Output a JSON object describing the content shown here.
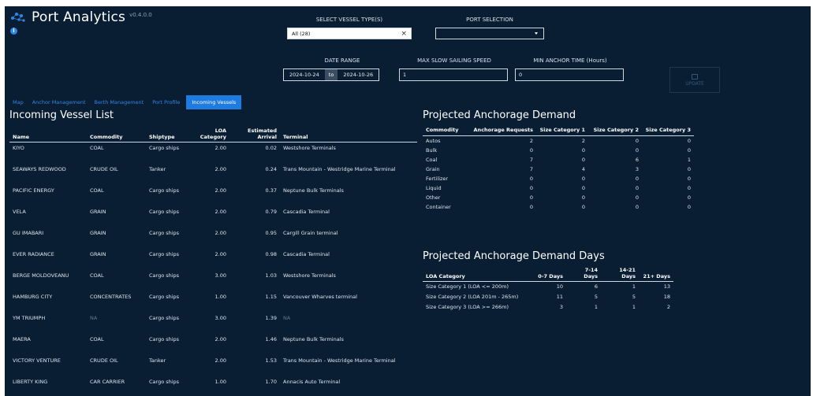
{
  "header": {
    "title": "Port Analytics",
    "version": "v0.4.0.0"
  },
  "filters": {
    "vessel_type_label": "SELECT VESSEL TYPE(S)",
    "vessel_type_value": "All (28)",
    "port_selection_label": "PORT SELECTION",
    "port_selection_value": "",
    "date_range_label": "DATE RANGE",
    "date_start": "2024-10-24",
    "date_to": "to",
    "date_end": "2024-10-26",
    "max_speed_label": "MAX SLOW SAILING SPEED",
    "max_speed_value": "1",
    "min_anchor_label": "MIN ANCHOR TIME (Hours)",
    "min_anchor_value": "0",
    "apply_label": "UPDATE"
  },
  "tabs": [
    {
      "label": "Map",
      "active": false
    },
    {
      "label": "Anchor Management",
      "active": false
    },
    {
      "label": "Berth Management",
      "active": false
    },
    {
      "label": "Port Profile",
      "active": false
    },
    {
      "label": "Incoming Vessels",
      "active": true
    }
  ],
  "vessel_list": {
    "title": "Incoming Vessel List",
    "headers": {
      "name": "Name",
      "commodity": "Commodity",
      "shiptype": "Shiptype",
      "loa_line1": "LOA",
      "loa_line2": "Category",
      "arrival_line1": "Estimated",
      "arrival_line2": "Arrival",
      "terminal": "Terminal"
    },
    "rows": [
      {
        "name": "KIYO",
        "commodity": "COAL",
        "shiptype": "Cargo ships",
        "loa": "2.00",
        "arrival": "0.02",
        "terminal": "Westshore Terminals"
      },
      {
        "name": "SEAWAYS REDWOOD",
        "commodity": "CRUDE OIL",
        "shiptype": "Tanker",
        "loa": "2.00",
        "arrival": "0.24",
        "terminal": "Trans Mountain - Westridge Marine Terminal"
      },
      {
        "name": "PACIFIC ENERGY",
        "commodity": "COAL",
        "shiptype": "Cargo ships",
        "loa": "2.00",
        "arrival": "0.37",
        "terminal": "Neptune Bulk Terminals"
      },
      {
        "name": "VELA",
        "commodity": "GRAIN",
        "shiptype": "Cargo ships",
        "loa": "2.00",
        "arrival": "0.79",
        "terminal": "Cascadia Terminal"
      },
      {
        "name": "GU IMABARI",
        "commodity": "GRAIN",
        "shiptype": "Cargo ships",
        "loa": "2.00",
        "arrival": "0.95",
        "terminal": "Cargill Grain terminal"
      },
      {
        "name": "EVER RADIANCE",
        "commodity": "GRAIN",
        "shiptype": "Cargo ships",
        "loa": "2.00",
        "arrival": "0.98",
        "terminal": "Cascadia Terminal"
      },
      {
        "name": "BERGE MOLDOVEANU",
        "commodity": "COAL",
        "shiptype": "Cargo ships",
        "loa": "3.00",
        "arrival": "1.03",
        "terminal": "Westshore Terminals"
      },
      {
        "name": "HAMBURG CITY",
        "commodity": "CONCENTRATES",
        "shiptype": "Cargo ships",
        "loa": "1.00",
        "arrival": "1.15",
        "terminal": "Vancouver Wharves terminal"
      },
      {
        "name": "YM TRIUMPH",
        "commodity": "NA",
        "shiptype": "Cargo ships",
        "loa": "3.00",
        "arrival": "1.39",
        "terminal": "NA"
      },
      {
        "name": "MAERA",
        "commodity": "COAL",
        "shiptype": "Cargo ships",
        "loa": "2.00",
        "arrival": "1.46",
        "terminal": "Neptune Bulk Terminals"
      },
      {
        "name": "VICTORY VENTURE",
        "commodity": "CRUDE OIL",
        "shiptype": "Tanker",
        "loa": "2.00",
        "arrival": "1.53",
        "terminal": "Trans Mountain - Westridge Marine Terminal"
      },
      {
        "name": "LIBERTY KING",
        "commodity": "CAR CARRIER",
        "shiptype": "Cargo ships",
        "loa": "1.00",
        "arrival": "1.70",
        "terminal": "Annacis Auto Terminal"
      }
    ]
  },
  "anchorage_demand": {
    "title": "Projected Anchorage Demand",
    "headers": [
      "Commodity",
      "Anchorage Requests",
      "Size Category 1",
      "Size Category 2",
      "Size Category 3"
    ],
    "rows": [
      [
        "Autos",
        "2",
        "2",
        "0",
        "0"
      ],
      [
        "Bulk",
        "0",
        "0",
        "0",
        "0"
      ],
      [
        "Coal",
        "7",
        "0",
        "6",
        "1"
      ],
      [
        "Grain",
        "7",
        "4",
        "3",
        "0"
      ],
      [
        "Fertilizer",
        "0",
        "0",
        "0",
        "0"
      ],
      [
        "Liquid",
        "0",
        "0",
        "0",
        "0"
      ],
      [
        "Other",
        "0",
        "0",
        "0",
        "0"
      ],
      [
        "Container",
        "0",
        "0",
        "0",
        "0"
      ]
    ]
  },
  "anchorage_days": {
    "title": "Projected Anchorage Demand Days",
    "headers": [
      "LOA Category",
      "0-7 Days",
      "7-14 Days",
      "14-21 Days",
      "21+ Days"
    ],
    "rows": [
      [
        "Size Category 1 (LOA <= 200m)",
        "10",
        "6",
        "1",
        "13"
      ],
      [
        "Size Category 2 (LOA 201m - 265m)",
        "11",
        "5",
        "5",
        "18"
      ],
      [
        "Size Category 3 (LOA >= 266m)",
        "3",
        "1",
        "1",
        "2"
      ]
    ]
  }
}
